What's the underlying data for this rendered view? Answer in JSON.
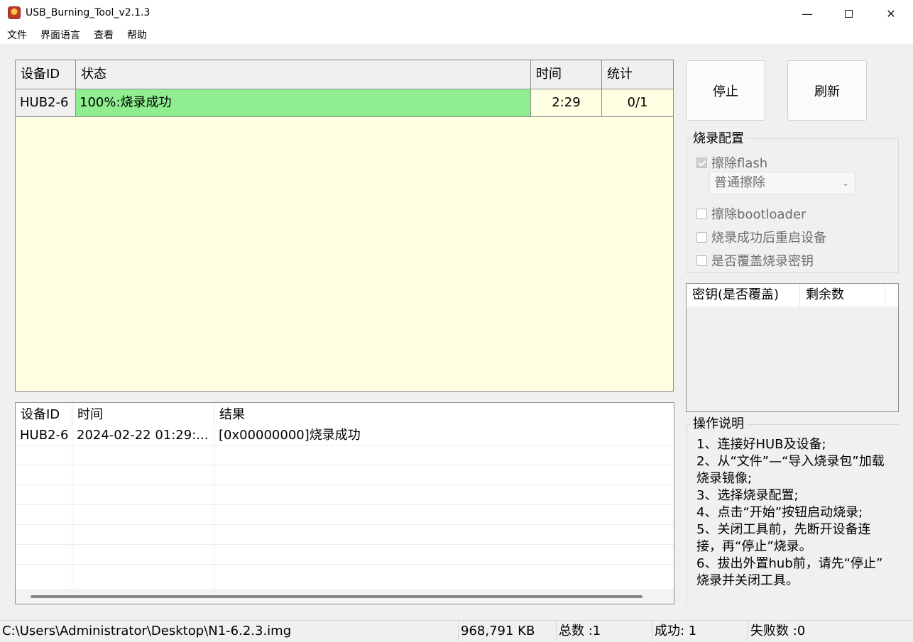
{
  "window": {
    "title": "USB_Burning_Tool_v2.1.3",
    "controls": {
      "minimize": "—",
      "close": "✕"
    }
  },
  "menu": [
    "文件",
    "界面语言",
    "查看",
    "帮助"
  ],
  "device_table": {
    "headers": [
      "设备ID",
      "状态",
      "时间",
      "统计"
    ],
    "rows": [
      {
        "id": "HUB2-6",
        "status": "100%:烧录成功",
        "time": "2:29",
        "stat": "0/1",
        "status_color": "#90ee90"
      }
    ],
    "background": "#ffffe1"
  },
  "buttons": {
    "stop": "停止",
    "refresh": "刷新"
  },
  "burn_config": {
    "title": "烧录配置",
    "erase_flash": {
      "label": "擦除flash",
      "checked": true
    },
    "erase_mode": "普通擦除",
    "erase_bootloader": {
      "label": "擦除bootloader",
      "checked": false
    },
    "reboot_after": {
      "label": "烧录成功后重启设备",
      "checked": false
    },
    "overwrite_key": {
      "label": "是否覆盖烧录密钥",
      "checked": false
    }
  },
  "key_table": {
    "headers": [
      "密钥(是否覆盖)",
      "剩余数"
    ]
  },
  "log_table": {
    "headers": [
      "设备ID",
      "时间",
      "结果"
    ],
    "rows": [
      {
        "id": "HUB2-6",
        "time": "2024-02-22 01:29:...",
        "result": "[0x00000000]烧录成功"
      }
    ]
  },
  "instructions": {
    "title": "操作说明",
    "lines": [
      "1、连接好HUB及设备;",
      "2、从“文件”—“导入烧录包”加载",
      "烧录镜像;",
      "3、选择烧录配置;",
      "4、点击“开始”按钮启动烧录;",
      "5、关闭工具前，先断开设备连",
      "接，再“停止”烧录。",
      "6、拔出外置hub前，请先“停止”",
      "烧录并关闭工具。"
    ]
  },
  "statusbar": {
    "path": "C:\\Users\\Administrator\\Desktop\\N1-6.2.3.img",
    "size": "968,791 KB",
    "total": "总数 :1",
    "success": "成功:  1",
    "fail": "失败数 :0"
  }
}
